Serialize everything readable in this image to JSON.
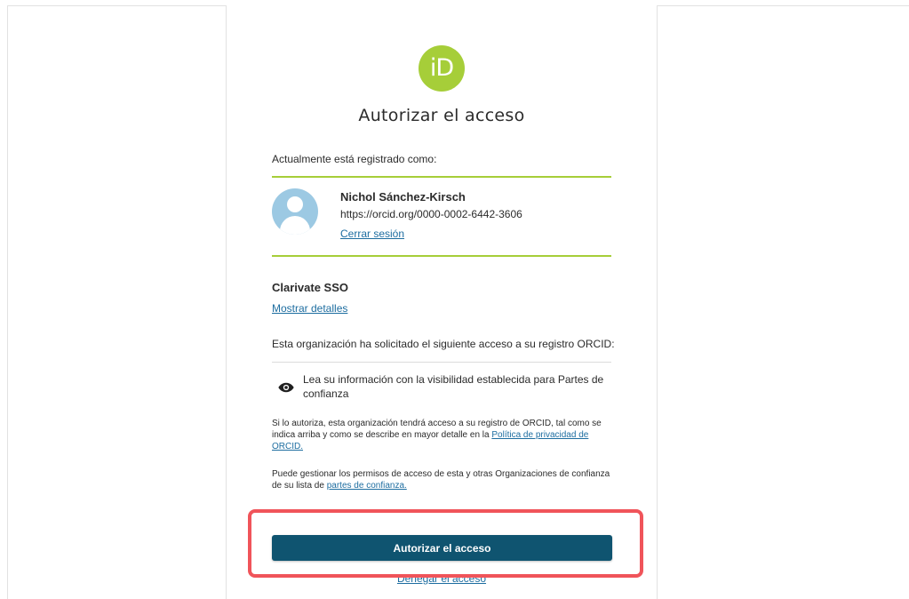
{
  "logo": {
    "text": "iD",
    "color": "#a6ce39"
  },
  "page": {
    "title": "Autorizar el acceso"
  },
  "session": {
    "label": "Actualmente está registrado como:",
    "user_name": "Nichol Sánchez-Kirsch",
    "user_url": "https://orcid.org/0000-0002-6442-3606",
    "signout_label": "Cerrar sesión"
  },
  "client": {
    "name": "Clarivate SSO",
    "details_label": "Mostrar detalles"
  },
  "request": {
    "intro": "Esta organización ha solicitado el siguiente acceso a su registro ORCID:",
    "permissions": [
      {
        "icon": "eye-icon",
        "text": "Lea su información con la visibilidad establecida para Partes de confianza"
      }
    ]
  },
  "notes": {
    "p1_text": "Si lo autoriza, esta organización tendrá acceso a su registro de ORCID, tal como se indica arriba y como se describe en mayor detalle en la ",
    "p1_link": "Política de privacidad de ORCID.",
    "p2_text": "Puede gestionar los permisos de acceso de esta y otras Organizaciones de confianza de su lista de ",
    "p2_link": "partes de confianza."
  },
  "actions": {
    "authorize_label": "Autorizar el acceso",
    "deny_label": "Denegar el acceso"
  },
  "colors": {
    "accent_green": "#a6ce39",
    "button_bg": "#0f5470",
    "link": "#1d6da0",
    "highlight": "#f0545a"
  }
}
